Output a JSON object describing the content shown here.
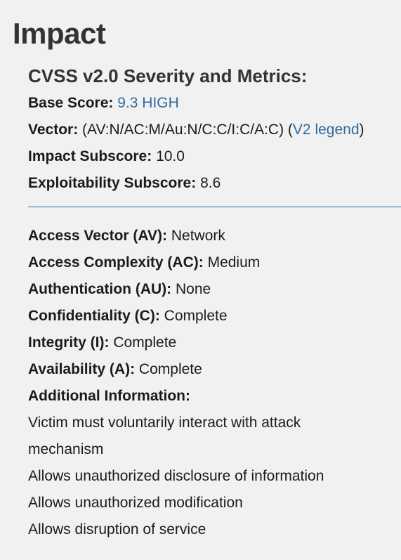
{
  "heading": "Impact",
  "cvss": {
    "title": "CVSS v2.0 Severity and Metrics:",
    "base_score_label": "Base Score:",
    "base_score_value": "9.3 HIGH",
    "vector_label": "Vector:",
    "vector_value": "(AV:N/AC:M/Au:N/C:C/I:C/A:C)",
    "vector_paren_open": "(",
    "vector_legend_link": "V2 legend",
    "vector_paren_close": ")",
    "impact_label": "Impact Subscore:",
    "impact_value": "10.0",
    "exploitability_label": "Exploitability Subscore:",
    "exploitability_value": "8.6"
  },
  "metrics": [
    {
      "label": "Access Vector (AV):",
      "value": "Network"
    },
    {
      "label": "Access Complexity (AC):",
      "value": "Medium"
    },
    {
      "label": "Authentication (AU):",
      "value": "None"
    },
    {
      "label": "Confidentiality (C):",
      "value": "Complete"
    },
    {
      "label": "Integrity (I):",
      "value": "Complete"
    },
    {
      "label": "Availability (A):",
      "value": "Complete"
    }
  ],
  "additional": {
    "label": "Additional Information:",
    "lines": [
      "Victim must voluntarily interact with attack mechanism",
      "Allows unauthorized disclosure of information",
      "Allows unauthorized modification",
      "Allows disruption of service"
    ]
  },
  "colors": {
    "link": "#2f6a9e",
    "background": "#f1f1f1",
    "text": "#1b1b1b"
  }
}
